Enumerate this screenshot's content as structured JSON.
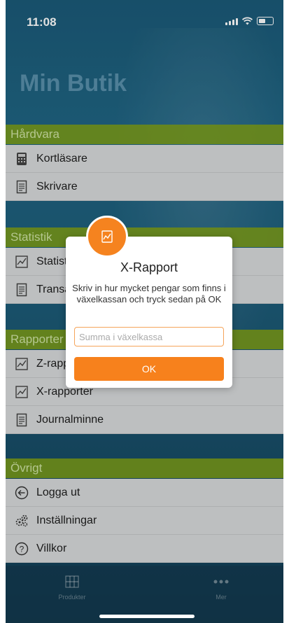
{
  "status_bar": {
    "time": "11:08"
  },
  "app": {
    "title": "Min Butik"
  },
  "sections": {
    "hardware": {
      "header": "Hårdvara",
      "items": [
        {
          "label": "Kortläsare"
        },
        {
          "label": "Skrivare"
        }
      ]
    },
    "statistics": {
      "header": "Statistik",
      "items": [
        {
          "label": "Statistik"
        },
        {
          "label": "Transaktioner"
        }
      ]
    },
    "reports": {
      "header": "Rapporter",
      "items": [
        {
          "label": "Z-rapporter"
        },
        {
          "label": "X-rapporter"
        },
        {
          "label": "Journalminne"
        }
      ]
    },
    "other": {
      "header": "Övrigt",
      "items": [
        {
          "label": "Logga ut"
        },
        {
          "label": "Inställningar"
        },
        {
          "label": "Villkor"
        }
      ]
    }
  },
  "tab_bar": {
    "tabs": [
      {
        "label": "Produkter",
        "icon": "grid-icon"
      },
      {
        "label": "Mer",
        "icon": "more-dots-icon"
      }
    ]
  },
  "dialog": {
    "badge_icon": "report-chart-icon",
    "title": "X-Rapport",
    "message": "Skriv in hur mycket pengar som finns i växelkassan och tryck sedan på OK",
    "input_placeholder": "Summa i växelkassa",
    "input_value": "",
    "ok_label": "OK"
  },
  "colors": {
    "accent": "#f7811c",
    "section_header": "#80a014",
    "list_background": "#d8dadb"
  }
}
